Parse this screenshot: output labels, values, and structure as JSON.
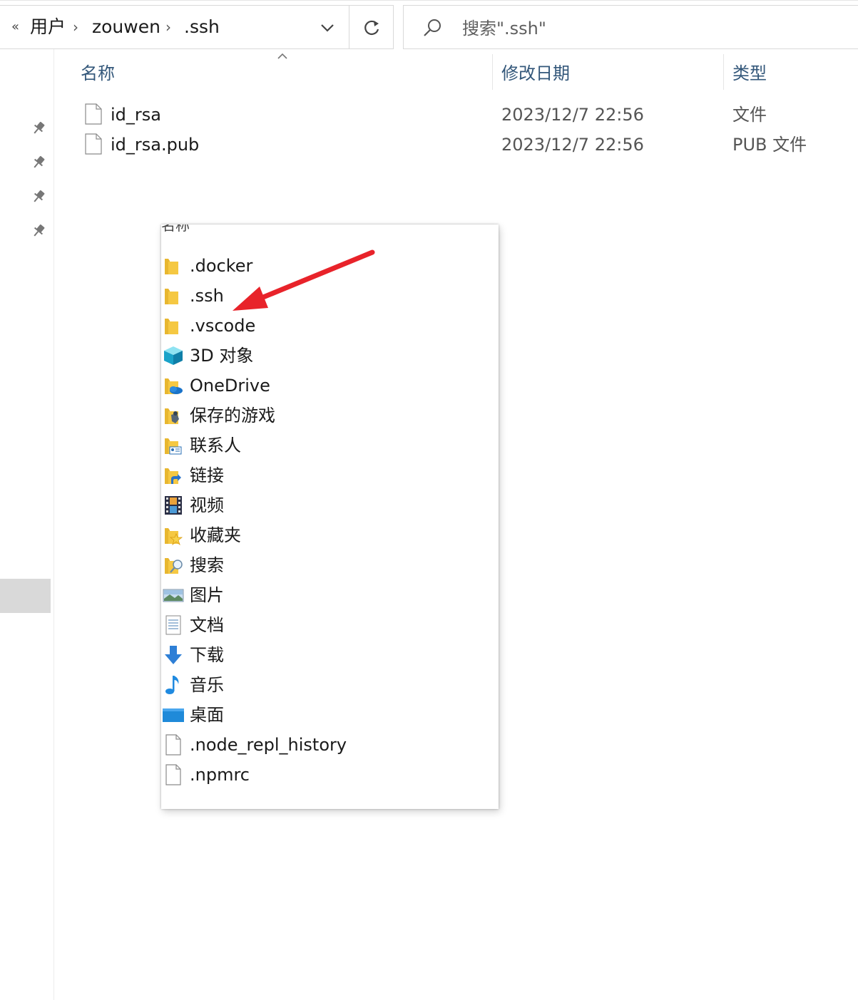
{
  "addressBar": {
    "overflow_icon": "«",
    "breadcrumbs": [
      "用户",
      "zouwen",
      ".ssh"
    ],
    "separator": "›"
  },
  "search": {
    "placeholder": "搜索\".ssh\""
  },
  "columns": {
    "name": "名称",
    "date": "修改日期",
    "type": "类型"
  },
  "files": [
    {
      "name": "id_rsa",
      "modified": "2023/12/7 22:56",
      "type": "文件"
    },
    {
      "name": "id_rsa.pub",
      "modified": "2023/12/7 22:56",
      "type": "PUB 文件"
    }
  ],
  "popup": {
    "header": "名称",
    "items": [
      {
        "label": ".docker",
        "icon": "folder-icon"
      },
      {
        "label": ".ssh",
        "icon": "folder-icon"
      },
      {
        "label": ".vscode",
        "icon": "folder-icon"
      },
      {
        "label": "3D 对象",
        "icon": "3d-objects-icon"
      },
      {
        "label": "OneDrive",
        "icon": "onedrive-folder-icon"
      },
      {
        "label": "保存的游戏",
        "icon": "saved-games-icon"
      },
      {
        "label": "联系人",
        "icon": "contacts-icon"
      },
      {
        "label": "链接",
        "icon": "links-icon"
      },
      {
        "label": "视频",
        "icon": "video-icon"
      },
      {
        "label": "收藏夹",
        "icon": "favorites-icon"
      },
      {
        "label": "搜索",
        "icon": "searches-icon"
      },
      {
        "label": "图片",
        "icon": "pictures-icon"
      },
      {
        "label": "文档",
        "icon": "documents-icon"
      },
      {
        "label": "下载",
        "icon": "downloads-icon"
      },
      {
        "label": "音乐",
        "icon": "music-icon"
      },
      {
        "label": "桌面",
        "icon": "desktop-icon"
      },
      {
        "label": ".node_repl_history",
        "icon": "file-icon"
      },
      {
        "label": ".npmrc",
        "icon": "file-icon"
      }
    ]
  },
  "colors": {
    "accent_arrow": "#e8232a",
    "column_header": "#33577a",
    "folder": "#f5c842"
  }
}
